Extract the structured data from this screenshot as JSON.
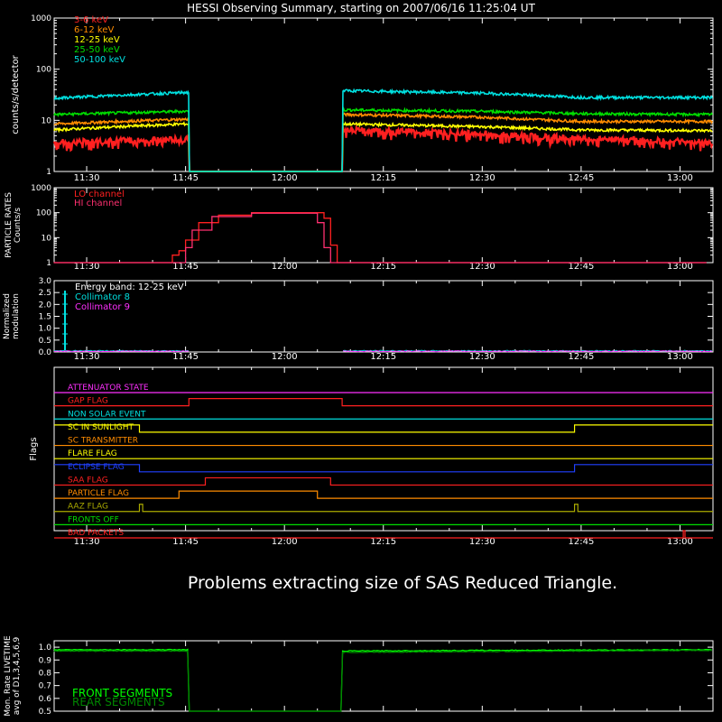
{
  "title": "HESSI Observing Summary, starting on 2007/06/16 11:25:04 UT",
  "message": "Problems extracting size of SAS Reduced Triangle.",
  "time_ticks": [
    "11:30",
    "11:45",
    "12:00",
    "12:15",
    "12:30",
    "12:45",
    "13:00"
  ],
  "chart_data": [
    {
      "type": "line",
      "panel": "count-rates",
      "ylabel": "counts/s/detector",
      "yscale": "log",
      "ylim": [
        1,
        1000
      ],
      "yticks": [
        "1",
        "10",
        "100",
        "1000"
      ],
      "xlim": [
        "11:25:04",
        "13:05:00"
      ],
      "gaps": [
        [
          "11:45:30",
          "12:08:45"
        ]
      ],
      "series": [
        {
          "name": "3-6 keV",
          "color": "#ff2020",
          "values": [
            [
              "11:25",
              3.8
            ],
            [
              "11:45",
              4.3
            ],
            [
              "12:09",
              6.8
            ],
            [
              "12:30",
              5.5
            ],
            [
              "12:45",
              4.5
            ],
            [
              "13:04",
              3.8
            ]
          ]
        },
        {
          "name": "6-12 keV",
          "color": "#ff8c00",
          "values": [
            [
              "11:25",
              8.5
            ],
            [
              "11:45",
              10.5
            ],
            [
              "12:09",
              13
            ],
            [
              "12:30",
              11.5
            ],
            [
              "12:45",
              9.5
            ],
            [
              "13:04",
              9.5
            ]
          ]
        },
        {
          "name": "12-25 keV",
          "color": "#ffff00",
          "values": [
            [
              "11:25",
              6.5
            ],
            [
              "11:45",
              8.5
            ],
            [
              "12:09",
              8.5
            ],
            [
              "12:30",
              7.5
            ],
            [
              "12:45",
              6.5
            ],
            [
              "13:04",
              6.3
            ]
          ]
        },
        {
          "name": "25-50 keV",
          "color": "#00dd00",
          "values": [
            [
              "11:25",
              13
            ],
            [
              "11:45",
              15
            ],
            [
              "12:09",
              16
            ],
            [
              "12:30",
              15
            ],
            [
              "12:45",
              13.5
            ],
            [
              "13:04",
              13
            ]
          ]
        },
        {
          "name": "50-100 keV",
          "color": "#00e0e0",
          "values": [
            [
              "11:25",
              27
            ],
            [
              "11:45",
              35
            ],
            [
              "12:09",
              38
            ],
            [
              "12:30",
              34
            ],
            [
              "12:45",
              28
            ],
            [
              "13:04",
              28
            ]
          ]
        }
      ]
    },
    {
      "type": "line",
      "panel": "particle-rates",
      "ylabel": "PARTICLE RATES Counts/s",
      "yscale": "log",
      "ylim": [
        1,
        1000
      ],
      "yticks": [
        "1",
        "10",
        "100",
        "1000"
      ],
      "series": [
        {
          "name": "LO channel",
          "color": "#ff2020",
          "values": [
            [
              "11:25",
              1
            ],
            [
              "11:42",
              1
            ],
            [
              "11:43",
              2
            ],
            [
              "11:44",
              3
            ],
            [
              "11:45",
              8
            ],
            [
              "11:47",
              40
            ],
            [
              "11:50",
              80
            ],
            [
              "11:55",
              100
            ],
            [
              "12:02",
              100
            ],
            [
              "12:06",
              60
            ],
            [
              "12:07",
              5
            ],
            [
              "12:08",
              1
            ],
            [
              "13:04",
              1
            ]
          ]
        },
        {
          "name": "HI channel",
          "color": "#ff3070",
          "values": [
            [
              "11:25",
              1
            ],
            [
              "11:44",
              1
            ],
            [
              "11:45",
              4
            ],
            [
              "11:46",
              20
            ],
            [
              "11:49",
              70
            ],
            [
              "11:55",
              95
            ],
            [
              "12:02",
              95
            ],
            [
              "12:05",
              40
            ],
            [
              "12:06",
              4
            ],
            [
              "12:07",
              1
            ],
            [
              "13:04",
              1
            ]
          ]
        }
      ]
    },
    {
      "type": "line",
      "panel": "modulation",
      "ylabel": "Normalized modulation",
      "ylim": [
        0,
        3
      ],
      "yticks": [
        "0.0",
        "0.5",
        "1.0",
        "1.5",
        "2.0",
        "2.5",
        "3.0"
      ],
      "annotation": "Energy band: 12-25 keV",
      "series": [
        {
          "name": "Collimator 8",
          "color": "#00e0e0",
          "values": [
            [
              "11:25",
              0.05
            ],
            [
              "11:45",
              0.05
            ],
            [
              "12:09",
              0.05
            ],
            [
              "13:04",
              0.05
            ]
          ]
        },
        {
          "name": "Collimator 9",
          "color": "#ff30ff",
          "values": [
            [
              "11:25",
              0.03
            ],
            [
              "11:45",
              0.03
            ],
            [
              "12:09",
              0.03
            ],
            [
              "13:04",
              0.03
            ]
          ]
        }
      ]
    },
    {
      "type": "line",
      "panel": "flags",
      "ylabel": "Flags",
      "series": [
        {
          "name": "ATTENUATOR STATE",
          "color": "#ff30ff",
          "high": []
        },
        {
          "name": "GAP FLAG",
          "color": "#ff2020",
          "high": [
            [
              "11:45:30",
              "12:08:45"
            ]
          ]
        },
        {
          "name": "NON SOLAR EVENT",
          "color": "#00e0e0",
          "high": []
        },
        {
          "name": "SC IN SUNLIGHT",
          "color": "#ffff00",
          "high": [
            [
              "11:25",
              "11:38"
            ],
            [
              "12:44",
              "13:05"
            ]
          ],
          "invert": true
        },
        {
          "name": "SC TRANSMITTER",
          "color": "#ff8c00",
          "high": []
        },
        {
          "name": "FLARE FLAG",
          "color": "#ffff00",
          "high": []
        },
        {
          "name": "ECLIPSE FLAG",
          "color": "#2040ff",
          "high": [
            [
              "11:25",
              "11:38"
            ],
            [
              "12:44",
              "13:05"
            ]
          ]
        },
        {
          "name": "SAA FLAG",
          "color": "#ff2020",
          "high": [
            [
              "11:48",
              "12:07"
            ]
          ]
        },
        {
          "name": "PARTICLE FLAG",
          "color": "#ff8c00",
          "high": [
            [
              "11:44",
              "12:05"
            ]
          ]
        },
        {
          "name": "AAZ FLAG",
          "color": "#aaaa00",
          "high": [
            [
              "11:38",
              "11:38:30"
            ],
            [
              "12:44",
              "12:44:30"
            ]
          ]
        },
        {
          "name": "FRONTS OFF",
          "color": "#00dd00",
          "high": []
        },
        {
          "name": "BAD PACKETS",
          "color": "#ff2020",
          "high": [
            [
              "13:00:30",
              "13:00:45"
            ]
          ]
        }
      ]
    },
    {
      "type": "line",
      "panel": "livetime",
      "ylabel": "Mon. Rate LIVETIME avg of D1,3,4,5,6,9",
      "ylim": [
        0.5,
        1.05
      ],
      "yticks": [
        "0.5",
        "0.6",
        "0.7",
        "0.8",
        "0.9",
        "1.0"
      ],
      "series": [
        {
          "name": "FRONT SEGMENTS",
          "color": "#00ff00",
          "values": [
            [
              "11:25",
              0.98
            ],
            [
              "11:45",
              0.98
            ],
            [
              "12:09",
              0.97
            ],
            [
              "12:30",
              0.975
            ],
            [
              "13:04",
              0.98
            ]
          ]
        },
        {
          "name": "REAR SEGMENTS",
          "color": "#008800",
          "values": [
            [
              "11:25",
              0.97
            ],
            [
              "11:45",
              0.97
            ],
            [
              "12:09",
              0.96
            ],
            [
              "13:04",
              0.975
            ]
          ]
        }
      ]
    }
  ]
}
